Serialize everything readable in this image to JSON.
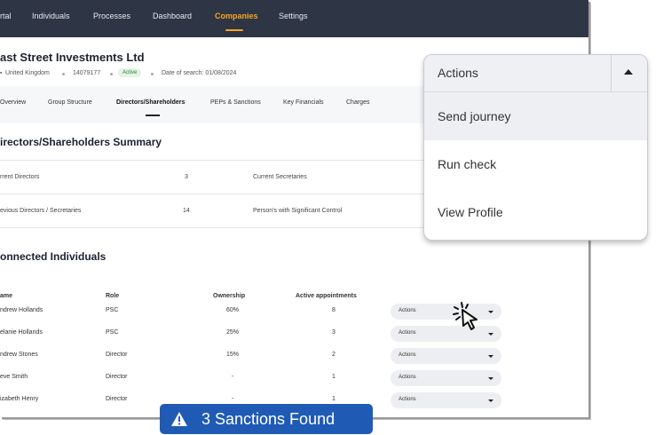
{
  "nav": {
    "items": [
      "rtal",
      "Individuals",
      "Processes",
      "Dashboard",
      "Companies",
      "Settings"
    ],
    "active": "Companies",
    "accent": "#f5a623",
    "background": "#2e3545"
  },
  "company": {
    "name": "ast Street Investments Ltd",
    "country": "United Kingdom",
    "number": "14079177",
    "status": "Active",
    "search_date": "Date of search: 01/08/2024"
  },
  "tabs": [
    "Overview",
    "Group Structure",
    "Directors/Shareholders",
    "PEPs & Sanctions",
    "Key Financials",
    "Charges"
  ],
  "summary": {
    "title": "irectors/Shareholders Summary",
    "rows": [
      {
        "label": "rrent Directors",
        "value": "3",
        "label2": "Current Secretaries"
      },
      {
        "label": "evious Directors / Secretaries",
        "value": "14",
        "label2": "Person's with Significant Control"
      }
    ]
  },
  "connected": {
    "title": "onnected Individuals",
    "headers": [
      "ame",
      "Role",
      "Ownership",
      "Active appointments"
    ],
    "rows": [
      {
        "name": "ndrew Hollands",
        "role": "PSC",
        "ownership": "60%",
        "appointments": "8",
        "action": "Actions"
      },
      {
        "name": "elanie Hollands",
        "role": "PSC",
        "ownership": "25%",
        "appointments": "3",
        "action": "Actions"
      },
      {
        "name": "ndrew Stones",
        "role": "Director",
        "ownership": "15%",
        "appointments": "2",
        "action": "Actions"
      },
      {
        "name": "eve Smith",
        "role": "Director",
        "ownership": "-",
        "appointments": "1",
        "action": "Actions"
      },
      {
        "name": "izabeth Henry",
        "role": "Director",
        "ownership": "-",
        "appointments": "1",
        "action": "Actions"
      }
    ]
  },
  "dropdown": {
    "label": "Actions",
    "items": [
      "Send journey",
      "Run check",
      "View Profile"
    ],
    "hovered": "Send journey"
  },
  "banner": {
    "text": "3 Sanctions Found",
    "color": "#1f5bb5",
    "icon": "warning-icon"
  }
}
